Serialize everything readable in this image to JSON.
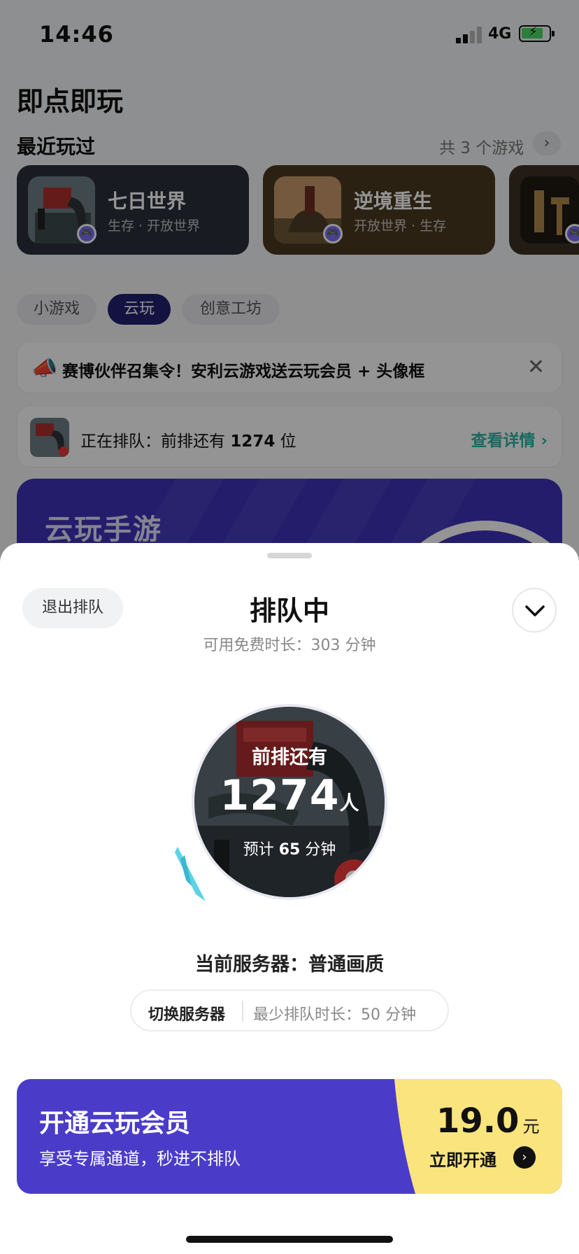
{
  "status_bar": {
    "time": "14:46",
    "network": "4G"
  },
  "header": {
    "title": "即点即玩"
  },
  "recent": {
    "title": "最近玩过",
    "count_label": "共 3 个游戏",
    "games": [
      {
        "name": "七日世界",
        "tags": "生存 · 开放世界"
      },
      {
        "name": "逆境重生",
        "tags": "开放世界 · 生存"
      },
      {
        "name": "",
        "tags": ""
      }
    ]
  },
  "tabs": [
    {
      "label": "小游戏",
      "active": false
    },
    {
      "label": "云玩",
      "active": true
    },
    {
      "label": "创意工坊",
      "active": false
    }
  ],
  "notice": {
    "text": "赛博伙伴召集令！安利云游戏送云玩会员 + 头像框"
  },
  "queue_row": {
    "prefix": "正在排队：前排还有 ",
    "count": "1274",
    "suffix": " 位",
    "link": "查看详情 ›"
  },
  "banner": {
    "title": "云玩手游"
  },
  "sheet": {
    "exit_label": "退出排队",
    "title": "排队中",
    "subtitle": "可用免费时长：303 分钟",
    "queue_label": "前排还有",
    "queue_count": "1274",
    "queue_unit": "人",
    "eta_prefix": "预计 ",
    "eta_value": "65",
    "eta_suffix": " 分钟",
    "server_line": "当前服务器：普通画质",
    "switch_label": "切换服务器",
    "min_wait": "最少排队时长：50 分钟"
  },
  "vip": {
    "title": "开通云玩会员",
    "subtitle": "享受专属通道，秒进不排队",
    "price": "19.0",
    "currency": "元",
    "cta": "立即开通"
  },
  "colors": {
    "accent_purple": "#4a3cc9",
    "tab_active_bg": "#24206e",
    "link_teal": "#2bb5a5",
    "vip_yellow": "#f9e47d"
  }
}
